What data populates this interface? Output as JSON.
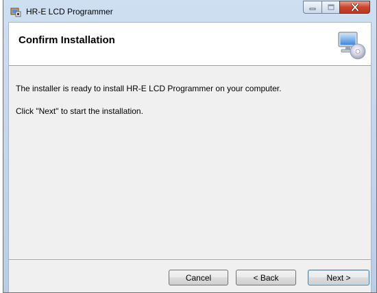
{
  "window": {
    "title": "HR-E LCD Programmer",
    "controls": {
      "minimize": "minimize",
      "maximize": "maximize",
      "close": "close"
    }
  },
  "banner": {
    "title": "Confirm Installation",
    "art_icon": "computer-cd-icon"
  },
  "content": {
    "line1": "The installer is ready to install HR-E LCD Programmer on your computer.",
    "line2": "Click \"Next\" to start the installation."
  },
  "buttons": {
    "cancel": "Cancel",
    "back": "< Back",
    "next": "Next >"
  },
  "colors": {
    "frame": "#b9cde6",
    "client": "#f0f0f0",
    "banner": "#ffffff",
    "close_button": "#c8452f",
    "default_button_border": "#3c7fb1"
  }
}
